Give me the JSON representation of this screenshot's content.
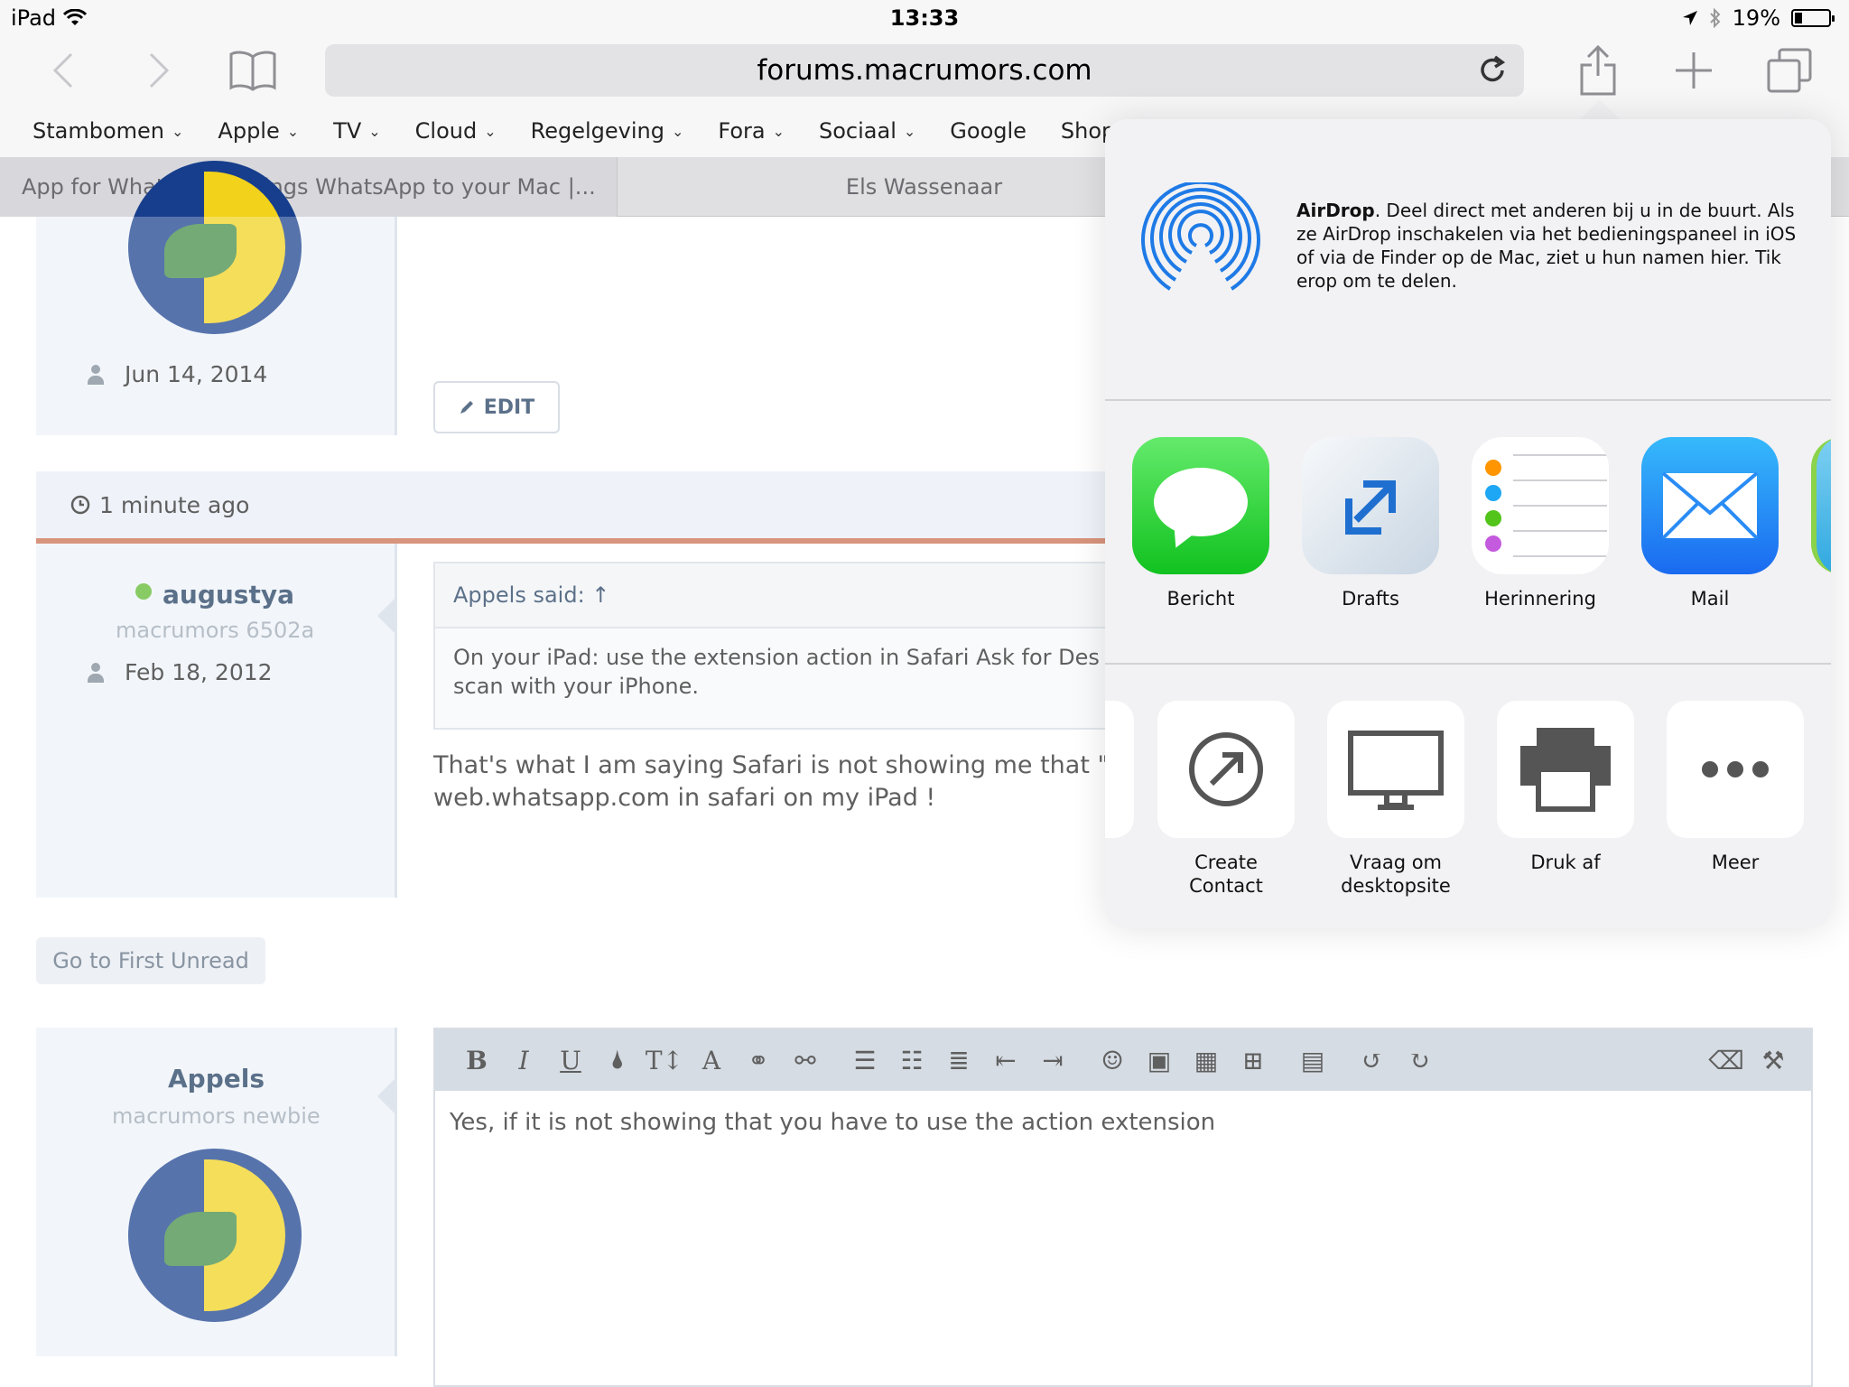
{
  "statusbar": {
    "device": "iPad",
    "time": "13:33",
    "battery": "19%"
  },
  "browser": {
    "url": "forums.macrumors.com",
    "favorites": [
      "Stambomen",
      "Apple",
      "TV",
      "Cloud",
      "Regelgeving",
      "Fora",
      "Sociaal",
      "Google",
      "Shopping"
    ],
    "favorites_with_chevron": [
      true,
      true,
      true,
      true,
      true,
      true,
      true,
      false,
      true
    ],
    "tabs": [
      "App for WhatsApp - Brings WhatsApp to your Mac |...",
      "Els Wassenaar"
    ]
  },
  "post1": {
    "date": "Jun 14, 2014",
    "edit_label": "EDIT"
  },
  "post2": {
    "time": "1 minute ago",
    "username": "augustya",
    "user_title": "macrumors 6502a",
    "joined": "Feb 18, 2012",
    "quote_head": "Appels said: ↑",
    "quote_line1": "On your iPad: use the extension action in Safari Ask for Des",
    "quote_line2": "scan with your iPhone.",
    "text_line1": "That's what I am saying Safari is not showing me that \"R",
    "text_line2": "web.whatsapp.com in safari on my iPad !"
  },
  "first_unread": "Go to First Unread",
  "reply": {
    "username": "Appels",
    "user_title": "macrumors newbie",
    "editor_text": "Yes, if it is not showing that you have to use the action extension"
  },
  "share_sheet": {
    "airdrop_title": "AirDrop",
    "airdrop_desc": ". Deel direct met anderen bij u in de buurt. Als ze AirDrop inschakelen via het bedieningspaneel in iOS of via de Finder op de Mac, ziet u hun namen hier. Tik erop om te delen.",
    "apps": [
      "Bericht",
      "Drafts",
      "Herinnering",
      "Mail"
    ],
    "actions": [
      "Create Contact",
      "Vraag om desktopsite",
      "Druk af",
      "Meer"
    ]
  },
  "colors": {
    "accent_orange": "#c96b4a",
    "online": "#5ab82a",
    "link": "#1d3a5c"
  }
}
